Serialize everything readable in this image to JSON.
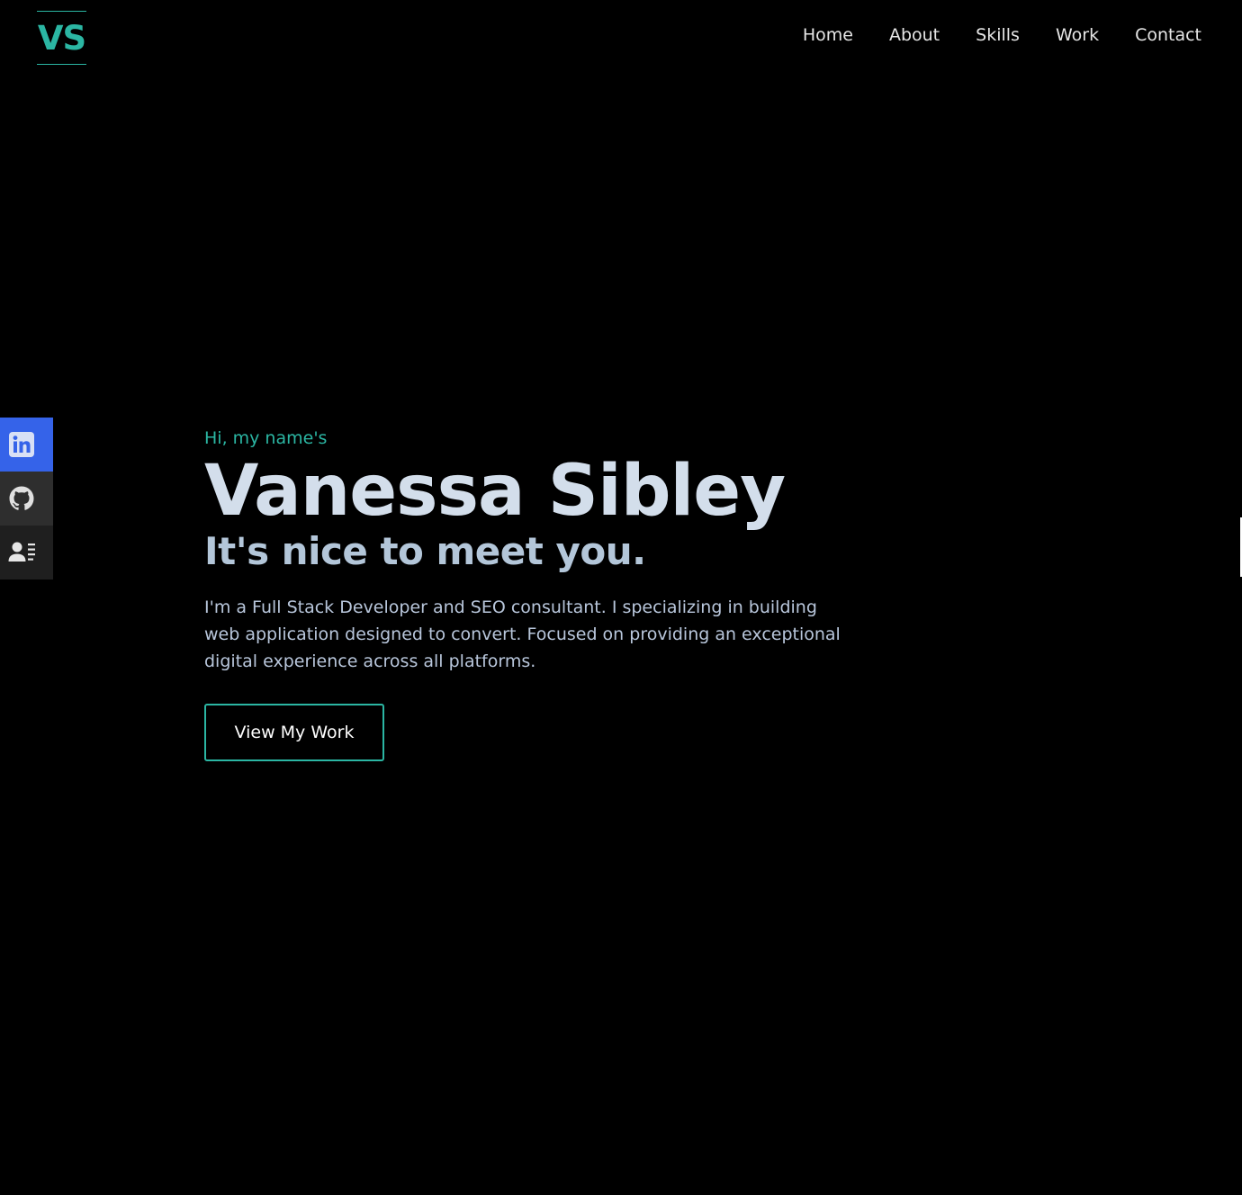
{
  "header": {
    "logo_text": "VS",
    "nav": [
      {
        "label": "Home"
      },
      {
        "label": "About"
      },
      {
        "label": "Skills"
      },
      {
        "label": "Work"
      },
      {
        "label": "Contact"
      }
    ]
  },
  "social": {
    "items": [
      {
        "icon": "linkedin-icon",
        "color": "#3563e9"
      },
      {
        "icon": "github-icon",
        "color": "#2e2e2e"
      },
      {
        "icon": "resume-icon",
        "color": "#1f1f1f"
      }
    ]
  },
  "hero": {
    "greeting": "Hi, my name's",
    "name": "Vanessa Sibley",
    "tagline": "It's nice to meet you.",
    "bio": "I'm a Full Stack Developer and SEO consultant. I specializing in building web application designed to convert. Focused on providing an exceptional digital experience across all platforms.",
    "cta_label": "View My Work"
  },
  "colors": {
    "background": "#000000",
    "accent": "#2bb6a3",
    "heading": "#d3deeb",
    "subheading": "#b3c6d9",
    "body_text": "#b8c6db"
  }
}
